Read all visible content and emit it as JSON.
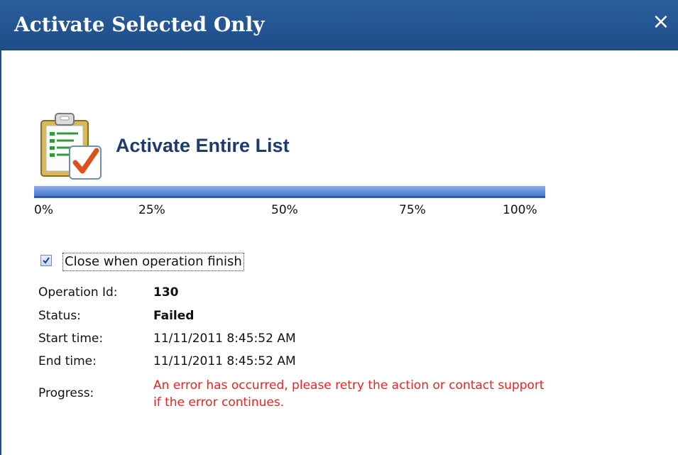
{
  "dialog": {
    "title": "Activate Selected Only",
    "close_glyph": "×"
  },
  "operation": {
    "icon": "clipboard-check-icon",
    "title": "Activate Entire List"
  },
  "progress_bar": {
    "percent": 100,
    "ticks": [
      "0%",
      "25%",
      "50%",
      "75%",
      "100%"
    ]
  },
  "close_when_finished": {
    "checked": true,
    "label": "Close when operation finish"
  },
  "info": {
    "operation_id_label": "Operation Id:",
    "operation_id_value": "130",
    "status_label": "Status:",
    "status_value": "Failed",
    "start_label": "Start time:",
    "start_value": "11/11/2011 8:45:52 AM",
    "end_label": "End time:",
    "end_value": "11/11/2011 8:45:52 AM",
    "progress_label": "Progress:",
    "progress_value": "An error has occurred, please retry the action or contact support if the error continues."
  },
  "colors": {
    "titlebar": "#1e4d88",
    "progress_fill": "#6a94dc",
    "error_text": "#ee2222"
  }
}
